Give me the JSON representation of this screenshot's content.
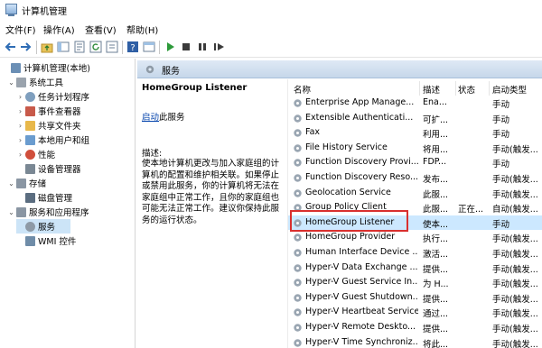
{
  "window": {
    "title": "计算机管理"
  },
  "menu": {
    "items": [
      "文件(F)",
      "操作(A)",
      "查看(V)",
      "帮助(H)"
    ]
  },
  "tree": {
    "items": [
      {
        "label": "计算机管理(本地)",
        "twisty": "",
        "icon": "computer-icon",
        "color": "#6b8fb5"
      },
      {
        "label": "系统工具",
        "twisty": "⌄",
        "icon": "tools-icon",
        "color": "#9aa3ad"
      },
      {
        "label": "任务计划程序",
        "twisty": "›",
        "icon": "clock-icon",
        "color": "#7f9fbe"
      },
      {
        "label": "事件查看器",
        "twisty": "›",
        "icon": "event-viewer-icon",
        "color": "#c85a4a"
      },
      {
        "label": "共享文件夹",
        "twisty": "›",
        "icon": "shared-folder-icon",
        "color": "#e8b84a"
      },
      {
        "label": "本地用户和组",
        "twisty": "›",
        "icon": "users-icon",
        "color": "#6a9ccf"
      },
      {
        "label": "性能",
        "twisty": "›",
        "icon": "performance-icon",
        "color": "#d04f3c"
      },
      {
        "label": "设备管理器",
        "twisty": "",
        "icon": "device-manager-icon",
        "color": "#7a8894"
      },
      {
        "label": "存储",
        "twisty": "⌄",
        "icon": "storage-icon",
        "color": "#8a96a3"
      },
      {
        "label": "磁盘管理",
        "twisty": "",
        "icon": "disk-icon",
        "color": "#5b6d80"
      },
      {
        "label": "服务和应用程序",
        "twisty": "⌄",
        "icon": "services-apps-icon",
        "color": "#8a96a3"
      },
      {
        "label": "服务",
        "twisty": "",
        "icon": "gear-icon",
        "color": "#8e9aa6"
      },
      {
        "label": "WMI 控件",
        "twisty": "",
        "icon": "wmi-icon",
        "color": "#6f8ca8"
      }
    ]
  },
  "header": {
    "title": "服务"
  },
  "detail": {
    "service_name": "HomeGroup Listener",
    "start_link": "启动",
    "start_suffix": "此服务",
    "desc_label": "描述:",
    "desc_text": "使本地计算机更改与加入家庭组的计算机的配置和维护相关联。如果停止或禁用此服务，你的计算机将无法在家庭组中正常工作，且你的家庭组也可能无法正常工作。建议你保持此服务的运行状态。"
  },
  "columns": {
    "name": "名称",
    "desc": "描述",
    "status": "状态",
    "start": "启动类型"
  },
  "services": [
    {
      "name": "Enterprise App Manage...",
      "desc": "Ena...",
      "status": "",
      "start": "手动"
    },
    {
      "name": "Extensible Authenticati...",
      "desc": "可扩...",
      "status": "",
      "start": "手动"
    },
    {
      "name": "Fax",
      "desc": "利用...",
      "status": "",
      "start": "手动"
    },
    {
      "name": "File History Service",
      "desc": "将用...",
      "status": "",
      "start": "手动(触发..."
    },
    {
      "name": "Function Discovery Provi...",
      "desc": "FDP...",
      "status": "",
      "start": "手动"
    },
    {
      "name": "Function Discovery Reso...",
      "desc": "发布...",
      "status": "",
      "start": "手动(触发..."
    },
    {
      "name": "Geolocation Service",
      "desc": "此服...",
      "status": "",
      "start": "手动(触发..."
    },
    {
      "name": "Group Policy Client",
      "desc": "此服...",
      "status": "正在...",
      "start": "自动(触发..."
    },
    {
      "name": "HomeGroup Listener",
      "desc": "使本...",
      "status": "",
      "start": "手动"
    },
    {
      "name": "HomeGroup Provider",
      "desc": "执行...",
      "status": "",
      "start": "手动(触发..."
    },
    {
      "name": "Human Interface Device ...",
      "desc": "激活...",
      "status": "",
      "start": "手动(触发..."
    },
    {
      "name": "Hyper-V Data Exchange ...",
      "desc": "提供...",
      "status": "",
      "start": "手动(触发..."
    },
    {
      "name": "Hyper-V Guest Service In...",
      "desc": "为 H...",
      "status": "",
      "start": "手动(触发..."
    },
    {
      "name": "Hyper-V Guest Shutdown...",
      "desc": "提供...",
      "status": "",
      "start": "手动(触发..."
    },
    {
      "name": "Hyper-V Heartbeat Service",
      "desc": "通过...",
      "status": "",
      "start": "手动(触发..."
    },
    {
      "name": "Hyper-V Remote Deskto...",
      "desc": "提供...",
      "status": "",
      "start": "手动(触发..."
    },
    {
      "name": "Hyper-V Time Synchroniz...",
      "desc": "将此...",
      "status": "",
      "start": "手动(触发..."
    }
  ],
  "selected_service_index": 8,
  "colors": {
    "selection": "#cce8ff",
    "header_bar": "#c6d7ea",
    "highlight_border": "#d9302f",
    "link": "#0645ad"
  }
}
